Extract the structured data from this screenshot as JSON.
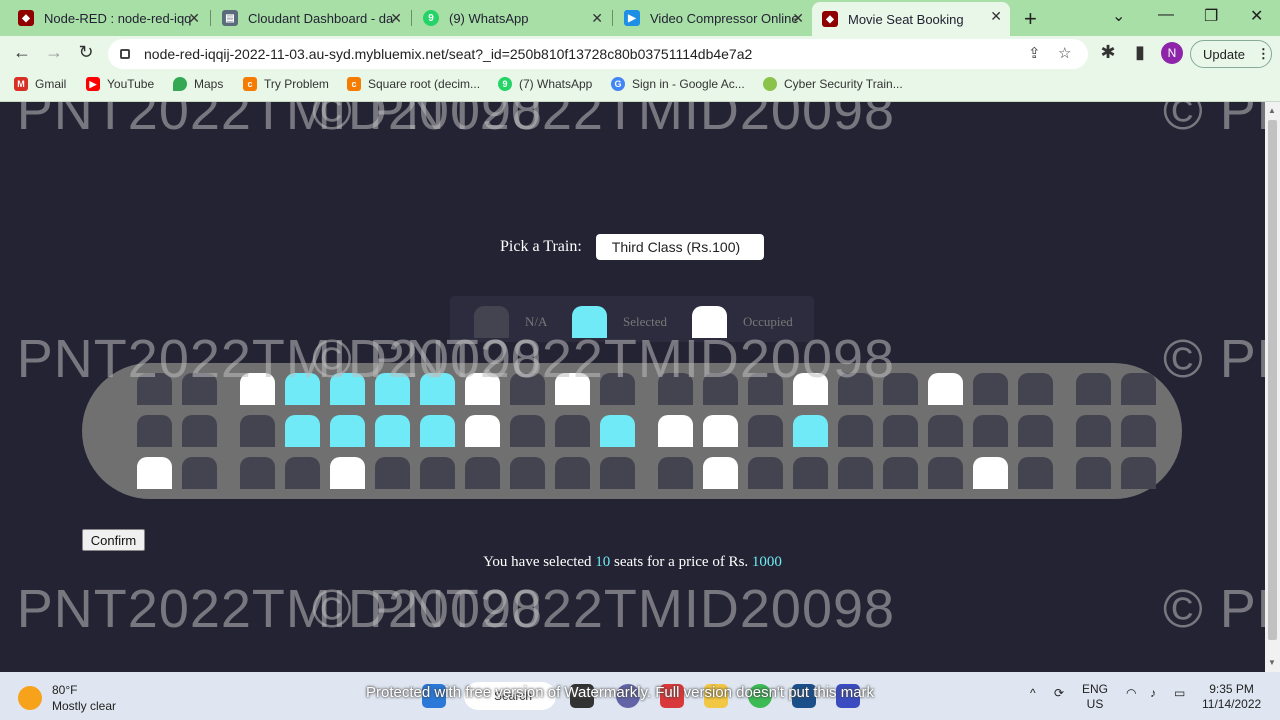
{
  "browser": {
    "tabs": [
      {
        "label": "Node-RED : node-red-iqq",
        "icon": "node-red-icon",
        "color": "#8f0000"
      },
      {
        "label": "Cloudant Dashboard - da",
        "icon": "cloudant-icon",
        "color": "#5a6b7c"
      },
      {
        "label": "(9) WhatsApp",
        "icon": "whatsapp-icon",
        "color": "#25d366"
      },
      {
        "label": "Video Compressor Online",
        "icon": "video-play-icon",
        "color": "#1f8fe5"
      },
      {
        "label": "Movie Seat Booking",
        "icon": "node-red-icon",
        "color": "#8f0000"
      }
    ],
    "url": "node-red-iqqij-2022-11-03.au-syd.mybluemix.net/seat?_id=250b810f13728c80b03751114db4e7a2",
    "profile_initial": "N",
    "update_label": "Update",
    "bookmarks": [
      {
        "label": "Gmail",
        "color": "#d93025",
        "icon": "gmail-icon"
      },
      {
        "label": "YouTube",
        "color": "#ff0000",
        "icon": "youtube-icon"
      },
      {
        "label": "Maps",
        "color": "#34a853",
        "icon": "maps-icon"
      },
      {
        "label": "Try Problem",
        "color": "#f57c00",
        "icon": "coding-icon"
      },
      {
        "label": "Square root (decim...",
        "color": "#f57c00",
        "icon": "coding-icon"
      },
      {
        "label": "(7) WhatsApp",
        "color": "#25d366",
        "icon": "whatsapp-icon"
      },
      {
        "label": "Sign in - Google Ac...",
        "color": "#4285f4",
        "icon": "google-icon"
      },
      {
        "label": "Cyber Security Train...",
        "color": "#8bc34a",
        "icon": "cyber-icon"
      }
    ]
  },
  "page": {
    "picker_label": "Pick a Train:",
    "picker_value": "Third Class (Rs.100)",
    "legend": [
      {
        "label": "N/A",
        "color": "#444451"
      },
      {
        "label": "Selected",
        "color": "#6feaf6"
      },
      {
        "label": "Occupied",
        "color": "#ffffff"
      }
    ],
    "seat_rows": [
      [
        "n",
        "n",
        "o",
        "s",
        "s",
        "s",
        "s",
        "o",
        "n",
        "o",
        "n",
        "n",
        "n",
        "n",
        "o",
        "n",
        "n",
        "o",
        "n",
        "n",
        "n",
        "n"
      ],
      [
        "n",
        "n",
        "n",
        "s",
        "s",
        "s",
        "s",
        "o",
        "n",
        "n",
        "s",
        "o",
        "o",
        "n",
        "s",
        "n",
        "n",
        "n",
        "n",
        "n",
        "n",
        "n"
      ],
      [
        "o",
        "n",
        "n",
        "n",
        "o",
        "n",
        "n",
        "n",
        "n",
        "n",
        "n",
        "n",
        "o",
        "n",
        "n",
        "n",
        "n",
        "n",
        "o",
        "n",
        "n",
        "n"
      ]
    ],
    "confirm_label": "Confirm",
    "summary_prefix": "You have selected",
    "selected_count": "10",
    "summary_middle": "seats for a price of Rs.",
    "total_price": "1000",
    "watermark": "© PNT2022TMID20098"
  },
  "taskbar": {
    "temperature": "80°F",
    "weather": "Mostly clear",
    "search_label": "Search",
    "overlay_notice": "Protected with free version of Watermarkly. Full version doesn't put this mark",
    "lang_top": "ENG",
    "lang_bottom": "US",
    "time": "9:35 PM",
    "date": "11/14/2022"
  }
}
